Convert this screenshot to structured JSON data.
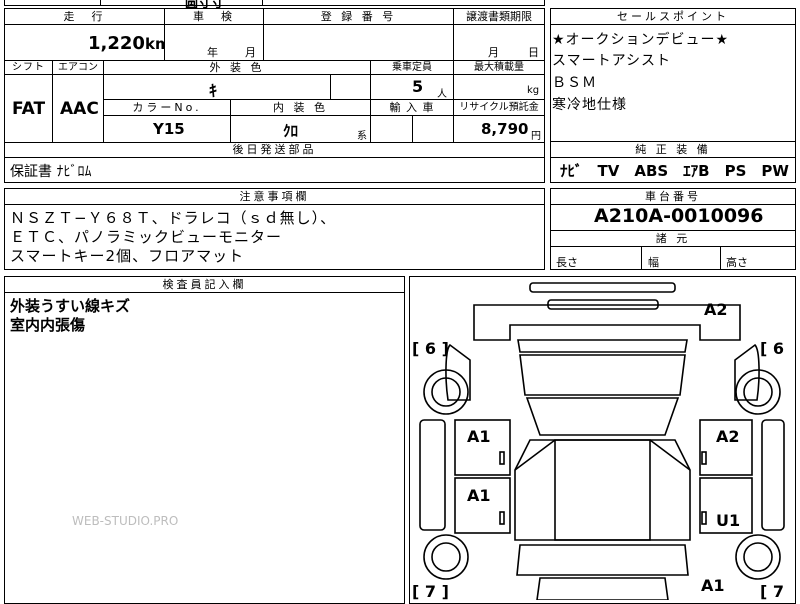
{
  "top_partial": {
    "left_fragment": "圆寸寸"
  },
  "headers": {
    "mileage": "走　行",
    "inspection": "車　検",
    "registration": "登 録 番 号",
    "transfer_deadline": "譲渡書類期限",
    "selling_points": "セールスポイント",
    "shift": "シフト",
    "aircon": "エアコン",
    "exterior_color": "外 装 色",
    "capacity": "乗車定員",
    "max_load": "最大積載量",
    "color_no": "カラーNo.",
    "interior_color": "内 装 色",
    "import": "輸 入 車",
    "recycle": "リサイクル預託金",
    "later_items": "後日発送部品",
    "standard_equipment": "純 正 装 備",
    "cautions": "注意事項欄",
    "chassis_no": "車台番号",
    "dimensions": "諸 元",
    "inspector_notes": "検査員記入欄"
  },
  "values": {
    "mileage": "1,220",
    "mileage_unit": "km",
    "inspection_year": "年",
    "inspection_month": "月",
    "transfer_month": "月",
    "transfer_day": "日",
    "shift": "FAT",
    "aircon": "AAC",
    "exterior_color": "ｷ",
    "capacity": "5",
    "capacity_unit": "人",
    "max_load_unit": "kg",
    "color_no": "Y15",
    "interior_color": "ｸﾛ",
    "interior_suffix": "系",
    "recycle": "8,790",
    "recycle_unit": "円",
    "later_items": "保証書 ﾅﾋﾞﾛﾑ",
    "standard_equipment": "ﾅﾋﾞ　TV　ABS　ｴｱB　PS　PW",
    "chassis_no": "A210A-0010096",
    "length": "長さ",
    "width": "幅",
    "height": "高さ"
  },
  "selling_points": [
    "★オークションデビュー★",
    "スマートアシスト",
    "ＢＳＭ",
    "寒冷地仕様"
  ],
  "cautions": [
    "ＮＳＺＴ−Ｙ６８Ｔ、ドラレコ（ｓｄ無し）、",
    "ＥＴＣ、パノラミックビューモニター",
    "スマートキー2個、フロアマット"
  ],
  "inspector_notes": [
    "外装うすい線キズ",
    "室内内張傷"
  ],
  "watermark": "WEB-STUDIO.PRO",
  "diagram": {
    "tire_left": "[ 6 ]",
    "tire_right": "[ 6",
    "tire_left_rear": "[ 7 ]",
    "tire_right_rear": "[ 7",
    "marks": {
      "roof": "A2",
      "front_left_door": "A1",
      "front_right_door": "A2",
      "rear_left_door": "A1",
      "rear_right_door": "U1",
      "rear_bumper": "A1"
    }
  }
}
